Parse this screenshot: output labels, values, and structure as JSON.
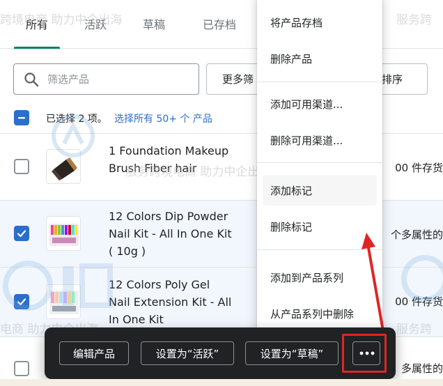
{
  "tabs": [
    {
      "label": "所有",
      "active": true
    },
    {
      "label": "活跃",
      "active": false
    },
    {
      "label": "草稿",
      "active": false
    },
    {
      "label": "已存档",
      "active": false
    }
  ],
  "search": {
    "placeholder": "筛选产品",
    "value": ""
  },
  "more_filters_label": "更多筛",
  "sort_label": "，排序",
  "bulk": {
    "selected_text": "已选择 2 项。",
    "select_all_link": "选择所有 50+ 个 产品"
  },
  "products": [
    {
      "name": "1 Foundation Makeup Brush Fiber hair",
      "inventory": "00 件存货",
      "checked": false
    },
    {
      "name": "12 Colors Dip Powder Nail Kit - All In One Kit ( 10g )",
      "inventory": "个多属性的",
      "checked": true
    },
    {
      "name": "12 Colors Poly Gel Nail Extension Kit - All In One Kit",
      "inventory": "00 件存货",
      "checked": true
    },
    {
      "name": "",
      "inventory": "多属性的",
      "checked": false
    }
  ],
  "menu": {
    "items": [
      "将产品存档",
      "删除产品",
      "添加可用渠道...",
      "删除可用渠道...",
      "添加标记",
      "删除标记",
      "添加到产品系列",
      "从产品系列中删除"
    ],
    "hovered_index": 4
  },
  "action_bar": {
    "edit": "编辑产品",
    "set_active": "设置为“活跃”",
    "set_draft": "设置为“草稿”"
  },
  "watermark": {
    "text_a": "跨境电商 助力中企出海",
    "text_b": "服务跨境电商 助力中企出海",
    "text_c": "服务跨",
    "text_d": "服务跨",
    "text_e": "电商 助力中企出海"
  },
  "colors": {
    "accent_green": "#008060",
    "checkbox_blue": "#2c6ecb",
    "action_bar_bg": "#202223",
    "highlight_red": "#e02424"
  }
}
